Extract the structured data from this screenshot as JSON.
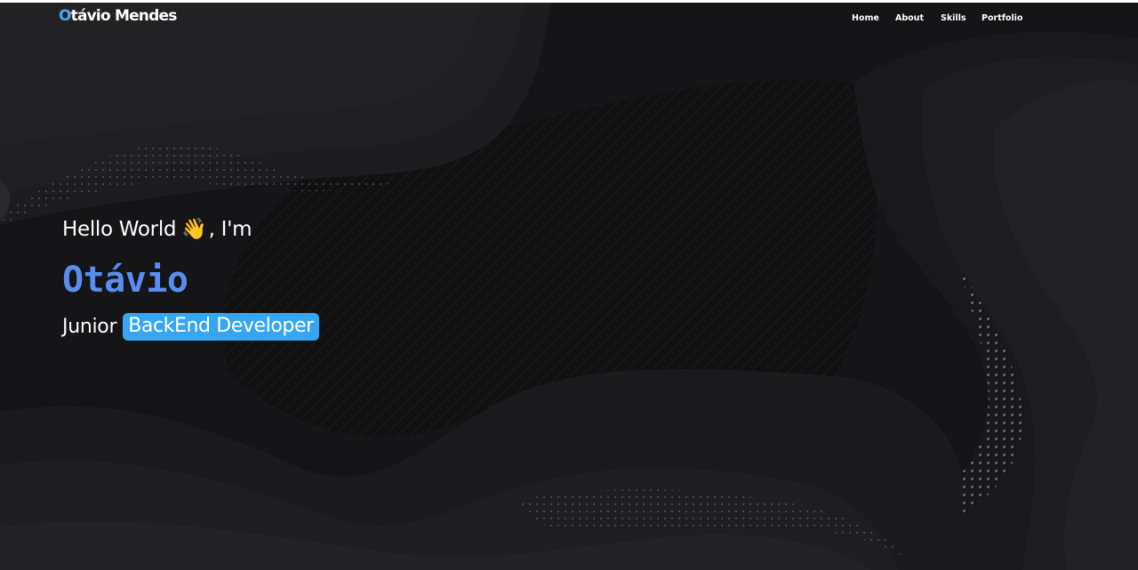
{
  "colors": {
    "background": "#161618",
    "accent_blue": "#36a6f2",
    "name_blue": "#5b8df0",
    "text": "#ffffff"
  },
  "navbar": {
    "logo_initial": "O",
    "logo_rest": "távio Mendes",
    "links": [
      {
        "label": "Home"
      },
      {
        "label": "About"
      },
      {
        "label": "Skills"
      },
      {
        "label": "Portfolio"
      }
    ]
  },
  "hero": {
    "greeting_start": "Hello World",
    "wave_icon": "👋",
    "greeting_end": ", I'm",
    "name": "Otávio",
    "role_prefix": "Junior",
    "role_badge": "BackEnd Developer"
  },
  "icons": {
    "wave": "waving-hand-icon"
  }
}
